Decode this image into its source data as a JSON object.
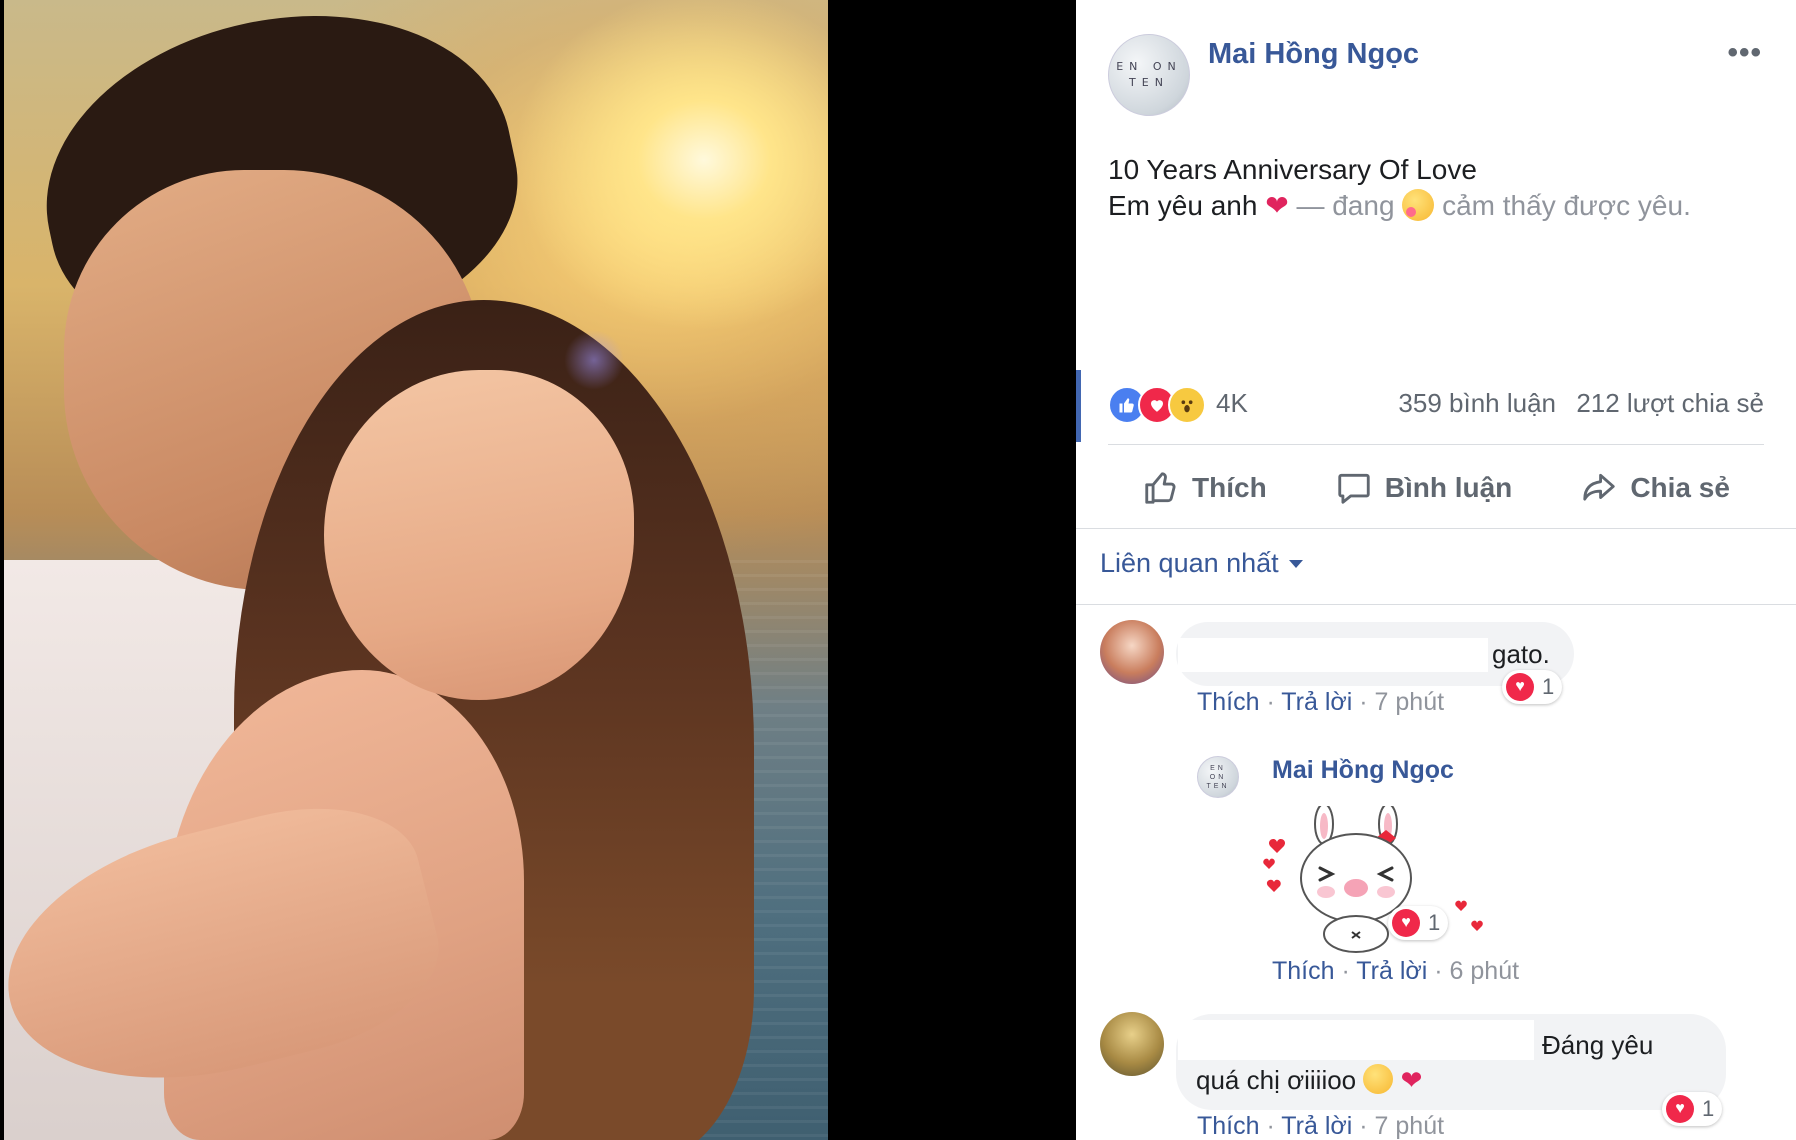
{
  "post": {
    "author": "Mai Hồng Ngọc",
    "avatar_text": "EN ON TEN",
    "more_label": "•••",
    "text_line1": "10 Years Anniversary Of Love",
    "text_line2_start": "Em yêu anh",
    "heart": "❤",
    "feeling_prefix": " — đang",
    "feeling_text": " cảm thấy được yêu."
  },
  "stats": {
    "reaction_count": "4K",
    "comments": "359 bình luận",
    "shares": "212 lượt chia sẻ"
  },
  "actions": {
    "like": "Thích",
    "comment": "Bình luận",
    "share": "Chia sẻ"
  },
  "sort": {
    "label": "Liên quan nhất"
  },
  "comments": [
    {
      "text": "gato.",
      "like": "Thích",
      "reply": "Trả lời",
      "time": "7 phút",
      "reaction_count": "1"
    },
    {
      "text_line1": "Đáng yêu",
      "text_line2": "quá chị ơiiiioo",
      "like": "Thích",
      "reply": "Trả lời",
      "time": "7 phút",
      "reaction_count": "1"
    }
  ],
  "reply": {
    "author": "Mai Hồng Ngọc",
    "avatar_text": "EN ON TEN",
    "like": "Thích",
    "reply": "Trả lời",
    "time": "6 phút",
    "reaction_count": "1",
    "sticker": "bunny-sticker"
  },
  "colors": {
    "link": "#385898",
    "muted": "#90949c",
    "love": "#f0284a",
    "like": "#4a7ff0",
    "accent": "#4267b2"
  }
}
